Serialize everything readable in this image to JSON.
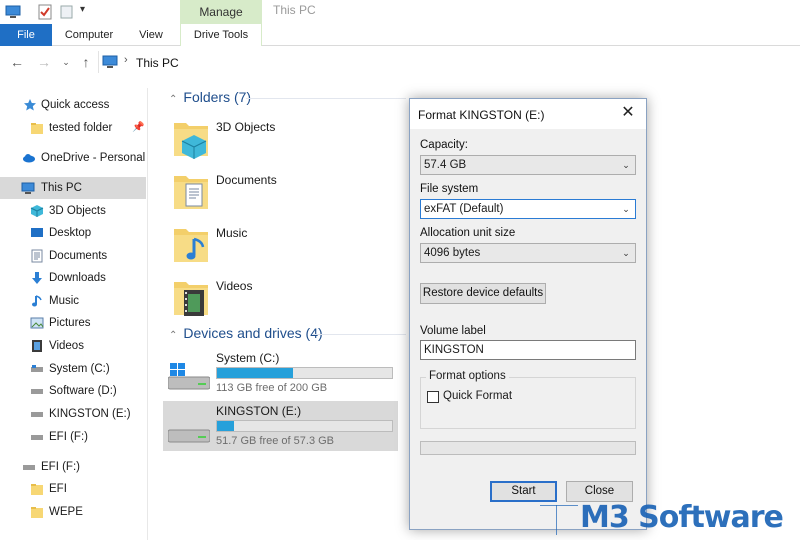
{
  "window": {
    "title": "This PC",
    "context_tab": "Manage"
  },
  "ribbon": {
    "tabs": [
      "File",
      "Computer",
      "View",
      "Drive Tools"
    ]
  },
  "address": {
    "path": "This PC"
  },
  "navpane": {
    "items": [
      {
        "label": "Quick access",
        "icon": "star-icon"
      },
      {
        "label": "tested folder",
        "icon": "folder-icon"
      },
      {
        "label": "OneDrive - Personal",
        "icon": "cloud-icon"
      },
      {
        "label": "This PC",
        "icon": "pc-icon"
      },
      {
        "label": "3D Objects",
        "icon": "cube-icon"
      },
      {
        "label": "Desktop",
        "icon": "desktop-icon"
      },
      {
        "label": "Documents",
        "icon": "document-icon"
      },
      {
        "label": "Downloads",
        "icon": "download-icon"
      },
      {
        "label": "Music",
        "icon": "music-icon"
      },
      {
        "label": "Pictures",
        "icon": "picture-icon"
      },
      {
        "label": "Videos",
        "icon": "video-icon"
      },
      {
        "label": "System (C:)",
        "icon": "drive-icon"
      },
      {
        "label": "Software (D:)",
        "icon": "drive-icon"
      },
      {
        "label": "KINGSTON (E:)",
        "icon": "drive-icon"
      },
      {
        "label": "EFI (F:)",
        "icon": "drive-icon"
      },
      {
        "label": "EFI (F:)",
        "icon": "drive-icon"
      },
      {
        "label": "EFI",
        "icon": "folder-icon"
      },
      {
        "label": "WEPE",
        "icon": "folder-icon"
      }
    ]
  },
  "content": {
    "folders_header": "Folders (7)",
    "folders": [
      "3D Objects",
      "Documents",
      "Music",
      "Videos"
    ],
    "drives_header": "Devices and drives (4)",
    "drives": [
      {
        "name": "System (C:)",
        "free": "113 GB free of 200 GB",
        "used_fraction": 0.435
      },
      {
        "name": "KINGSTON (E:)",
        "free": "51.7 GB free of 57.3 GB",
        "used_fraction": 0.098
      }
    ]
  },
  "dialog": {
    "title": "Format KINGSTON (E:)",
    "capacity_label": "Capacity:",
    "capacity_value": "57.4 GB",
    "filesystem_label": "File system",
    "filesystem_value": "exFAT (Default)",
    "alloc_label": "Allocation unit size",
    "alloc_value": "4096 bytes",
    "restore_button": "Restore device defaults",
    "volume_label": "Volume label",
    "volume_value": "KINGSTON",
    "format_options": "Format options",
    "quick_format": "Quick Format",
    "start_button": "Start",
    "close_button": "Close"
  },
  "watermark": {
    "text1": "M3",
    "text2": " Software"
  },
  "colors": {
    "accent": "#1f6fc5",
    "manage_tab": "#d7ebc9",
    "bar_fill": "#26a0da",
    "selection": "#d9d9d9"
  }
}
